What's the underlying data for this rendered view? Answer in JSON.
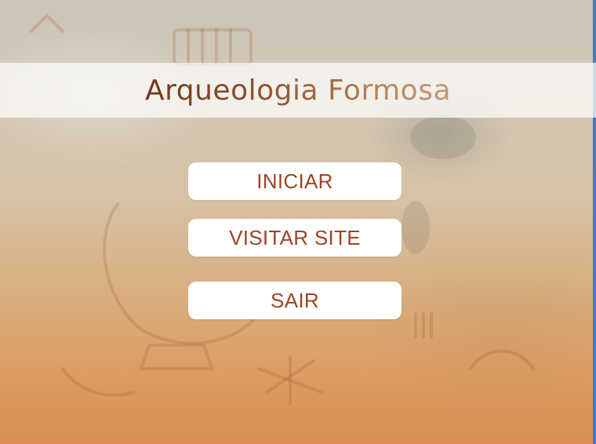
{
  "app": {
    "title": "Arqueologia Formosa"
  },
  "menu": {
    "start_label": "INICIAR",
    "visit_site_label": "VISITAR SITE",
    "exit_label": "SAIR"
  },
  "colors": {
    "title_gradient_start": "#6e3a1c",
    "title_gradient_end": "#c79a77",
    "button_background": "#ffffff",
    "button_text": "#9c4526",
    "background_top": "#cbc4b7",
    "background_bottom": "#d88e52"
  }
}
